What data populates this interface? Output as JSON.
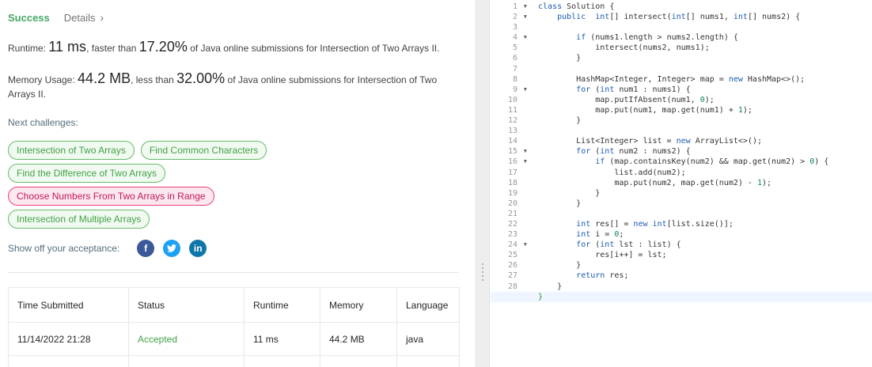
{
  "tabs": {
    "success": "Success",
    "details": "Details"
  },
  "runtime": {
    "label": "Runtime:",
    "value": "11 ms",
    "mid": ", faster than",
    "percent": "17.20%",
    "tail": "of Java online submissions for Intersection of Two Arrays II."
  },
  "memory": {
    "label": "Memory Usage:",
    "value": "44.2 MB",
    "mid": ", less than",
    "percent": "32.00%",
    "tail": "of Java online submissions for Intersection of Two Arrays II."
  },
  "next_challenges_label": "Next challenges:",
  "challenges": [
    {
      "label": "Intersection of Two Arrays",
      "difficulty": "easy"
    },
    {
      "label": "Find Common Characters",
      "difficulty": "easy"
    },
    {
      "label": "Find the Difference of Two Arrays",
      "difficulty": "easy"
    },
    {
      "label": "Choose Numbers From Two Arrays in Range",
      "difficulty": "hard"
    },
    {
      "label": "Intersection of Multiple Arrays",
      "difficulty": "easy"
    }
  ],
  "share": {
    "label": "Show off your acceptance:",
    "icons": [
      {
        "name": "facebook-icon",
        "glyph": "f"
      },
      {
        "name": "twitter-icon",
        "glyph": "t"
      },
      {
        "name": "linkedin-icon",
        "glyph": "in"
      }
    ]
  },
  "table": {
    "headers": [
      "Time Submitted",
      "Status",
      "Runtime",
      "Memory",
      "Language"
    ],
    "rows": [
      [
        "11/14/2022 21:28",
        "Accepted",
        "11 ms",
        "44.2 MB",
        "java"
      ]
    ]
  },
  "colors": {
    "accent_green": "#43a047",
    "hard_pink": "#c2185b",
    "keyword_blue": "#1c5bb0"
  },
  "editor": {
    "line_numbers": [
      "1",
      "2",
      "3",
      "4",
      "5",
      "6",
      "7",
      "8",
      "9",
      "10",
      "11",
      "12",
      "13",
      "14",
      "15",
      "16",
      "17",
      "18",
      "19",
      "20",
      "21",
      "22",
      "23",
      "24",
      "25",
      "26",
      "27",
      "28",
      "29"
    ],
    "fold_lines": [
      1,
      2,
      4,
      9,
      15,
      16,
      24
    ],
    "active_line": 29
  }
}
